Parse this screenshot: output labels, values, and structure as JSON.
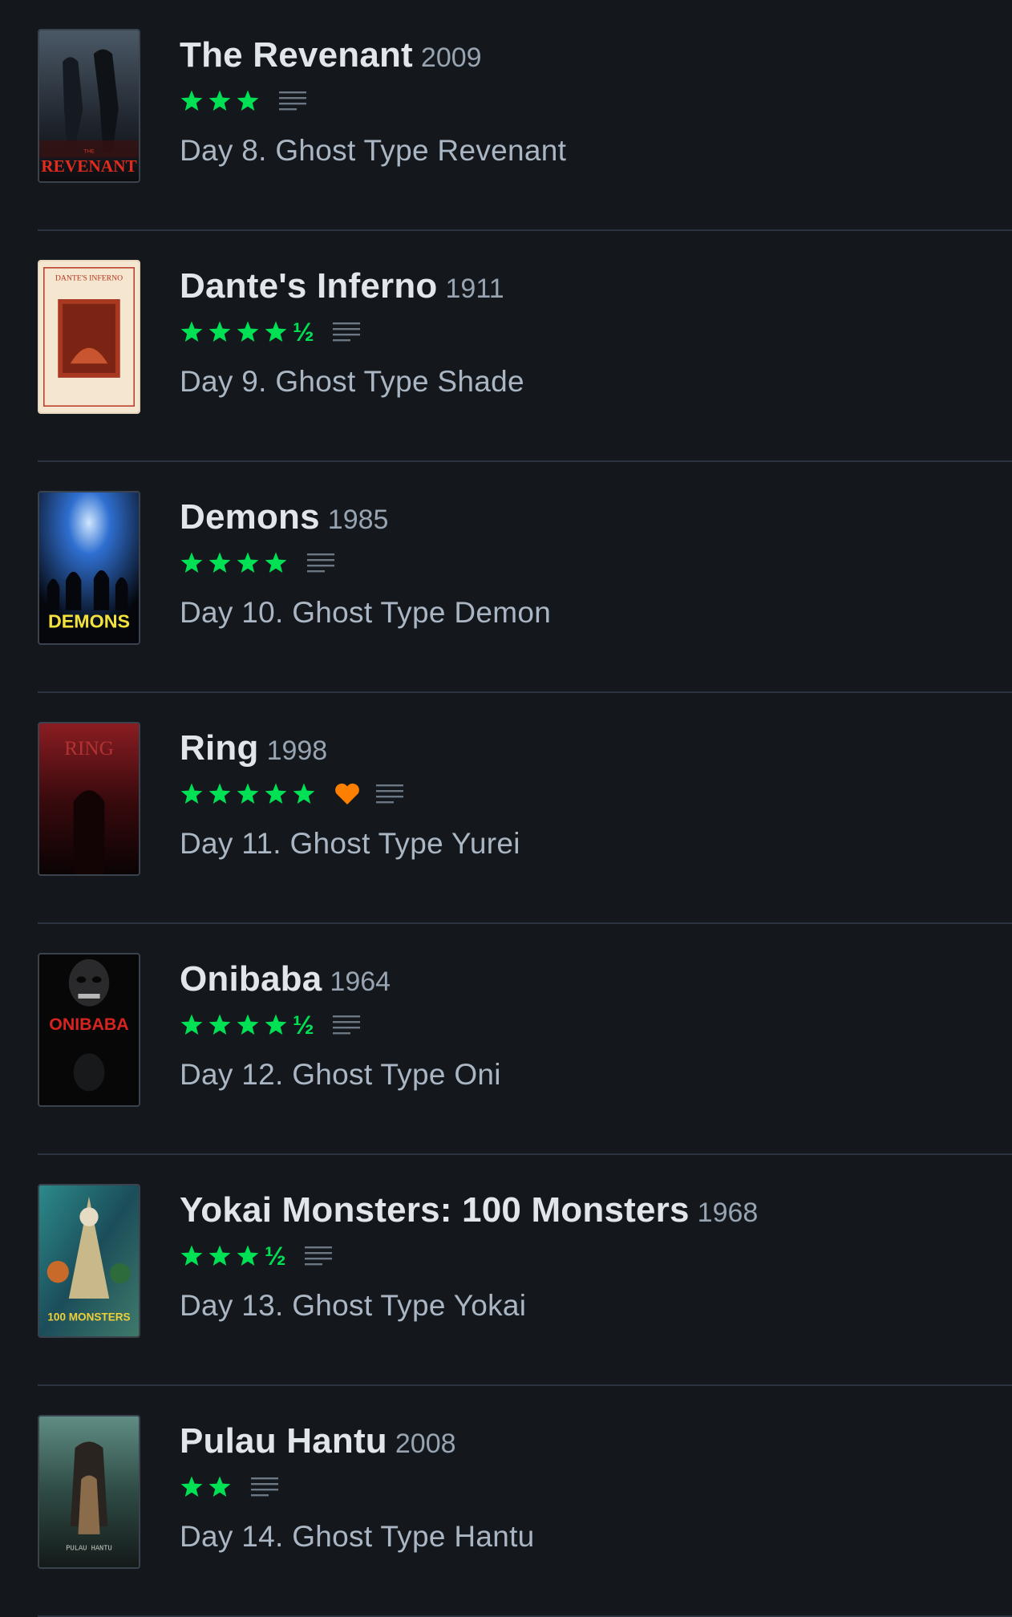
{
  "colors": {
    "background": "#14181c",
    "star": "#00e054",
    "heart": "#ff8000",
    "title": "#e1e6ec",
    "year": "#98a4b2",
    "note": "#aab6c3",
    "divider": "#2c3440",
    "review_icon": "#6b7785"
  },
  "entries": [
    {
      "title": "The Revenant",
      "year": "2009",
      "rating_stars": 3,
      "half_star": false,
      "half_label": "½",
      "liked": false,
      "has_review": true,
      "review_icon": "review-lines-icon",
      "note": "Day 8. Ghost Type Revenant",
      "poster_text": "REVENANT",
      "poster_subtext": "THE"
    },
    {
      "title": "Dante's Inferno",
      "year": "1911",
      "rating_stars": 4,
      "half_star": true,
      "half_label": "½",
      "liked": false,
      "has_review": true,
      "review_icon": "review-lines-icon",
      "note": "Day 9. Ghost Type Shade",
      "poster_text": "DANTE'S INFERNO"
    },
    {
      "title": "Demons",
      "year": "1985",
      "rating_stars": 4,
      "half_star": false,
      "half_label": "½",
      "liked": false,
      "has_review": true,
      "review_icon": "review-lines-icon",
      "note": "Day 10. Ghost Type Demon",
      "poster_text": "DEMONS"
    },
    {
      "title": "Ring",
      "year": "1998",
      "rating_stars": 5,
      "half_star": false,
      "half_label": "½",
      "liked": true,
      "like_icon": "heart-icon",
      "has_review": true,
      "review_icon": "review-lines-icon",
      "note": "Day 11. Ghost Type Yurei",
      "poster_text": "RING"
    },
    {
      "title": "Onibaba",
      "year": "1964",
      "rating_stars": 4,
      "half_star": true,
      "half_label": "½",
      "liked": false,
      "has_review": true,
      "review_icon": "review-lines-icon",
      "note": "Day 12. Ghost Type Oni",
      "poster_text": "ONIBABA"
    },
    {
      "title": "Yokai Monsters: 100 Monsters",
      "year": "1968",
      "rating_stars": 3,
      "half_star": true,
      "half_label": "½",
      "liked": false,
      "has_review": true,
      "review_icon": "review-lines-icon",
      "note": "Day 13. Ghost Type Yokai",
      "poster_text": "100 MONSTERS"
    },
    {
      "title": "Pulau Hantu",
      "year": "2008",
      "rating_stars": 2,
      "half_star": false,
      "half_label": "½",
      "liked": false,
      "has_review": true,
      "review_icon": "review-lines-icon",
      "note": "Day 14. Ghost Type Hantu",
      "poster_text": "PULAU HANTU"
    }
  ]
}
